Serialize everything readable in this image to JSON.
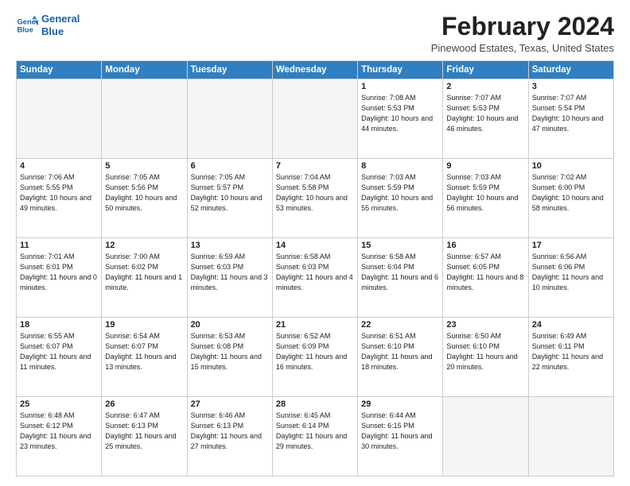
{
  "logo": {
    "line1": "General",
    "line2": "Blue"
  },
  "title": "February 2024",
  "subtitle": "Pinewood Estates, Texas, United States",
  "days_of_week": [
    "Sunday",
    "Monday",
    "Tuesday",
    "Wednesday",
    "Thursday",
    "Friday",
    "Saturday"
  ],
  "weeks": [
    [
      {
        "day": "",
        "empty": true
      },
      {
        "day": "",
        "empty": true
      },
      {
        "day": "",
        "empty": true
      },
      {
        "day": "",
        "empty": true
      },
      {
        "day": "1",
        "sunrise": "7:08 AM",
        "sunset": "5:53 PM",
        "daylight": "10 hours and 44 minutes."
      },
      {
        "day": "2",
        "sunrise": "7:07 AM",
        "sunset": "5:53 PM",
        "daylight": "10 hours and 46 minutes."
      },
      {
        "day": "3",
        "sunrise": "7:07 AM",
        "sunset": "5:54 PM",
        "daylight": "10 hours and 47 minutes."
      }
    ],
    [
      {
        "day": "4",
        "sunrise": "7:06 AM",
        "sunset": "5:55 PM",
        "daylight": "10 hours and 49 minutes."
      },
      {
        "day": "5",
        "sunrise": "7:05 AM",
        "sunset": "5:56 PM",
        "daylight": "10 hours and 50 minutes."
      },
      {
        "day": "6",
        "sunrise": "7:05 AM",
        "sunset": "5:57 PM",
        "daylight": "10 hours and 52 minutes."
      },
      {
        "day": "7",
        "sunrise": "7:04 AM",
        "sunset": "5:58 PM",
        "daylight": "10 hours and 53 minutes."
      },
      {
        "day": "8",
        "sunrise": "7:03 AM",
        "sunset": "5:59 PM",
        "daylight": "10 hours and 55 minutes."
      },
      {
        "day": "9",
        "sunrise": "7:03 AM",
        "sunset": "5:59 PM",
        "daylight": "10 hours and 56 minutes."
      },
      {
        "day": "10",
        "sunrise": "7:02 AM",
        "sunset": "6:00 PM",
        "daylight": "10 hours and 58 minutes."
      }
    ],
    [
      {
        "day": "11",
        "sunrise": "7:01 AM",
        "sunset": "6:01 PM",
        "daylight": "11 hours and 0 minutes."
      },
      {
        "day": "12",
        "sunrise": "7:00 AM",
        "sunset": "6:02 PM",
        "daylight": "11 hours and 1 minute."
      },
      {
        "day": "13",
        "sunrise": "6:59 AM",
        "sunset": "6:03 PM",
        "daylight": "11 hours and 3 minutes."
      },
      {
        "day": "14",
        "sunrise": "6:58 AM",
        "sunset": "6:03 PM",
        "daylight": "11 hours and 4 minutes."
      },
      {
        "day": "15",
        "sunrise": "6:58 AM",
        "sunset": "6:04 PM",
        "daylight": "11 hours and 6 minutes."
      },
      {
        "day": "16",
        "sunrise": "6:57 AM",
        "sunset": "6:05 PM",
        "daylight": "11 hours and 8 minutes."
      },
      {
        "day": "17",
        "sunrise": "6:56 AM",
        "sunset": "6:06 PM",
        "daylight": "11 hours and 10 minutes."
      }
    ],
    [
      {
        "day": "18",
        "sunrise": "6:55 AM",
        "sunset": "6:07 PM",
        "daylight": "11 hours and 11 minutes."
      },
      {
        "day": "19",
        "sunrise": "6:54 AM",
        "sunset": "6:07 PM",
        "daylight": "11 hours and 13 minutes."
      },
      {
        "day": "20",
        "sunrise": "6:53 AM",
        "sunset": "6:08 PM",
        "daylight": "11 hours and 15 minutes."
      },
      {
        "day": "21",
        "sunrise": "6:52 AM",
        "sunset": "6:09 PM",
        "daylight": "11 hours and 16 minutes."
      },
      {
        "day": "22",
        "sunrise": "6:51 AM",
        "sunset": "6:10 PM",
        "daylight": "11 hours and 18 minutes."
      },
      {
        "day": "23",
        "sunrise": "6:50 AM",
        "sunset": "6:10 PM",
        "daylight": "11 hours and 20 minutes."
      },
      {
        "day": "24",
        "sunrise": "6:49 AM",
        "sunset": "6:11 PM",
        "daylight": "11 hours and 22 minutes."
      }
    ],
    [
      {
        "day": "25",
        "sunrise": "6:48 AM",
        "sunset": "6:12 PM",
        "daylight": "11 hours and 23 minutes."
      },
      {
        "day": "26",
        "sunrise": "6:47 AM",
        "sunset": "6:13 PM",
        "daylight": "11 hours and 25 minutes."
      },
      {
        "day": "27",
        "sunrise": "6:46 AM",
        "sunset": "6:13 PM",
        "daylight": "11 hours and 27 minutes."
      },
      {
        "day": "28",
        "sunrise": "6:45 AM",
        "sunset": "6:14 PM",
        "daylight": "11 hours and 29 minutes."
      },
      {
        "day": "29",
        "sunrise": "6:44 AM",
        "sunset": "6:15 PM",
        "daylight": "11 hours and 30 minutes."
      },
      {
        "day": "",
        "empty": true
      },
      {
        "day": "",
        "empty": true
      }
    ]
  ]
}
